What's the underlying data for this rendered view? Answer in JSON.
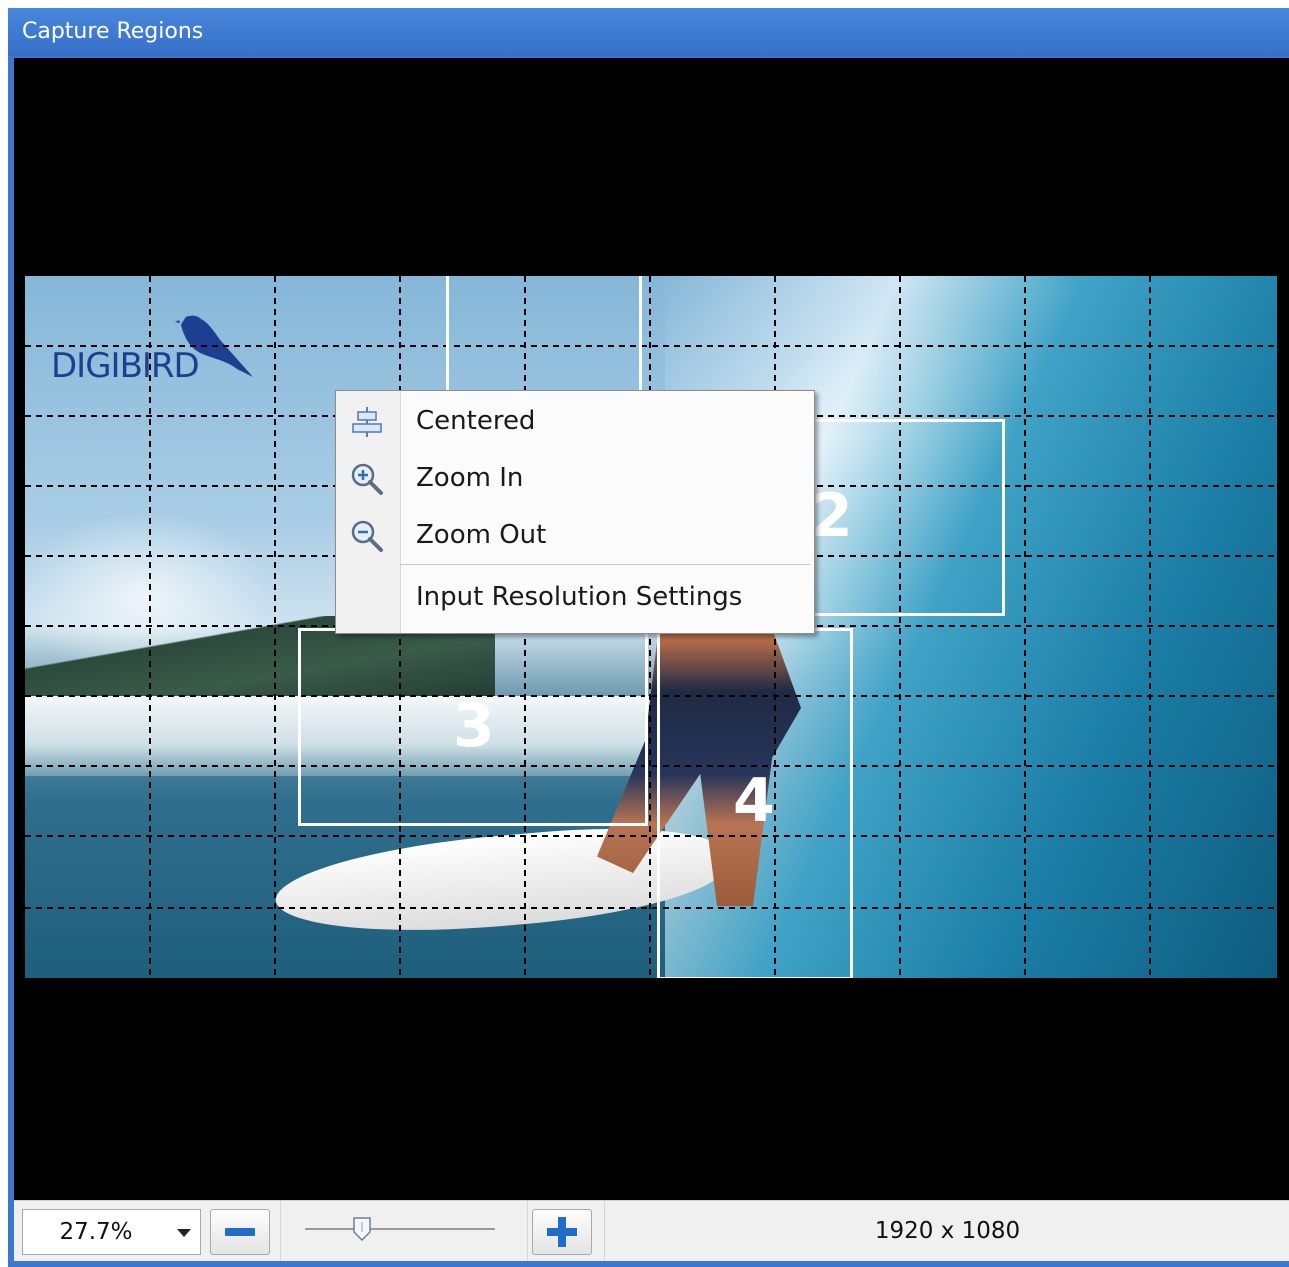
{
  "window": {
    "title": "Capture Regions"
  },
  "canvas": {
    "logo_text": "DIGIBIRD",
    "regions": [
      {
        "label": "2"
      },
      {
        "label": "3"
      },
      {
        "label": "4"
      }
    ]
  },
  "context_menu": {
    "items": [
      {
        "label": "Centered",
        "icon": "center-align-icon"
      },
      {
        "label": "Zoom In",
        "icon": "zoom-in-icon"
      },
      {
        "label": "Zoom Out",
        "icon": "zoom-out-icon"
      },
      {
        "label": "Input Resolution Settings",
        "icon": ""
      }
    ]
  },
  "toolbar": {
    "zoom_value": "27.7%",
    "zoom_slider_level": 0.3,
    "resolution": "1920 x 1080"
  },
  "colors": {
    "title_bar": "#3c78d0",
    "accent": "#1f6dc9",
    "canvas_bg": "#000000"
  }
}
